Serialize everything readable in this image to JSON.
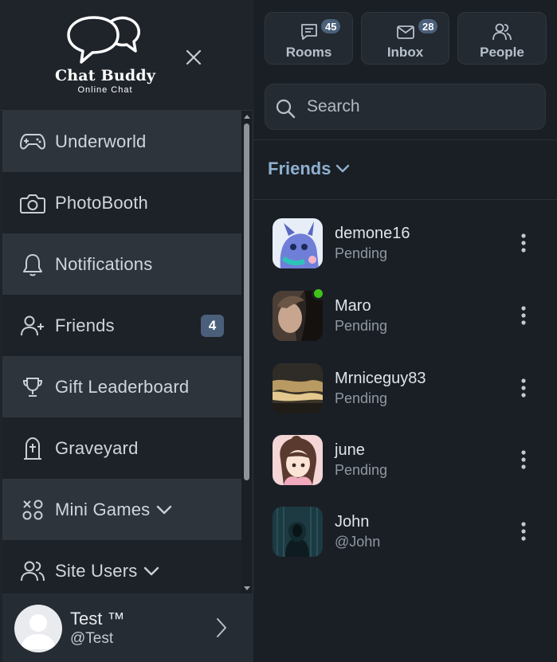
{
  "brand": {
    "title": "Chat Buddy",
    "subtitle": "Online Chat"
  },
  "sidebar": {
    "items": [
      {
        "label": "Underworld",
        "icon": "gamepad-icon"
      },
      {
        "label": "PhotoBooth",
        "icon": "camera-icon"
      },
      {
        "label": "Notifications",
        "icon": "bell-icon"
      },
      {
        "label": "Friends",
        "icon": "user-plus-icon",
        "badge": "4"
      },
      {
        "label": "Gift Leaderboard",
        "icon": "trophy-icon"
      },
      {
        "label": "Graveyard",
        "icon": "tombstone-icon"
      },
      {
        "label": "Mini Games",
        "icon": "games-icon"
      },
      {
        "label": "Site Users",
        "icon": "users-icon"
      }
    ]
  },
  "profile": {
    "name": "Test ™",
    "handle": "@Test"
  },
  "tabs": [
    {
      "label": "Rooms",
      "count": "45",
      "icon": "chat-bubble-icon"
    },
    {
      "label": "Inbox",
      "count": "28",
      "icon": "mail-icon"
    },
    {
      "label": "People",
      "icon": "people-icon"
    }
  ],
  "search": {
    "placeholder": "Search"
  },
  "friends": {
    "heading": "Friends",
    "list": [
      {
        "name": "demone16",
        "status": "Pending",
        "online": false
      },
      {
        "name": "Maro",
        "status": "Pending",
        "online": true
      },
      {
        "name": "Mrniceguy83",
        "status": "Pending",
        "online": false
      },
      {
        "name": "june",
        "status": "Pending",
        "online": false
      },
      {
        "name": "John",
        "status": "@John",
        "online": false
      }
    ]
  },
  "colors": {
    "sidebar_bg": "#1f242b",
    "panel_bg": "#1a1f25",
    "accent_blue": "#8fb0d0",
    "badge_bg": "#4a5f7a",
    "online": "#3fc21a"
  }
}
